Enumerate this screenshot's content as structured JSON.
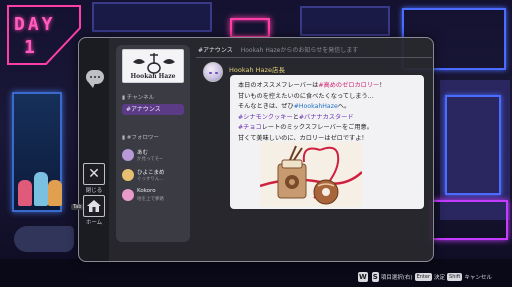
{
  "scene": {
    "day_label": "DAY",
    "day_number": "1"
  },
  "rail": {
    "close_label": "閉じる",
    "home_label": "ホーム",
    "tab_key": "Tab"
  },
  "channel_panel": {
    "logo_text": "Hookah Haze",
    "channel_section": "チャンネル",
    "channels": [
      {
        "label": "#アナウンス",
        "selected": true
      }
    ],
    "follower_section": "#フォロワー",
    "followers": [
      {
        "name": "あむ",
        "status": "か見ってそ~",
        "color": "#b89ad8"
      },
      {
        "name": "ひよこまめ",
        "status": "ぐっすりん...",
        "color": "#e6c070"
      },
      {
        "name": "Kokoro",
        "status": "地を上で夢路",
        "color": "#e89ac8"
      }
    ]
  },
  "feed": {
    "channel_title": "#アナウンス",
    "hint": "Hookah Hazeからのお知らせを発信します",
    "post": {
      "author": "Hookah Haze店長",
      "lines": [
        {
          "parts": [
            {
              "t": "本日のオススメフレーバーは"
            },
            {
              "t": "#高めのゼロカロリー",
              "c": "hl-pink"
            },
            {
              "t": "！"
            }
          ]
        },
        {
          "parts": [
            {
              "t": "甘いものを控えたいのに食べたくなってしまう…"
            }
          ]
        },
        {
          "parts": [
            {
              "t": "そんなときは、ぜひ"
            },
            {
              "t": "#HookahHaze",
              "c": "hl-blue"
            },
            {
              "t": "へ。"
            }
          ]
        },
        {
          "parts": [
            {
              "t": "#シナモンクッキー",
              "c": "hl-purple"
            },
            {
              "t": "と"
            },
            {
              "t": "#バナナカスタード",
              "c": "hl-purple"
            }
          ]
        },
        {
          "parts": [
            {
              "t": "#チョコ",
              "c": "hl-purple"
            },
            {
              "t": "レートのミックスフレーバーをご用意。"
            }
          ]
        },
        {
          "parts": [
            {
              "t": "甘くて美味しいのに、カロリーはゼロですよ！"
            }
          ]
        }
      ]
    }
  },
  "footer": {
    "k1": "W",
    "k2": "S",
    "select_label": "項目選択(右)",
    "enter_key": "Enter",
    "decide_label": "決定",
    "shift_key": "Shift",
    "cancel_label": "キャンセル"
  },
  "colors": {
    "accent_pink": "#ff3fa8",
    "channel_selected": "#5b3a86",
    "author_gold": "#e6d27a"
  }
}
